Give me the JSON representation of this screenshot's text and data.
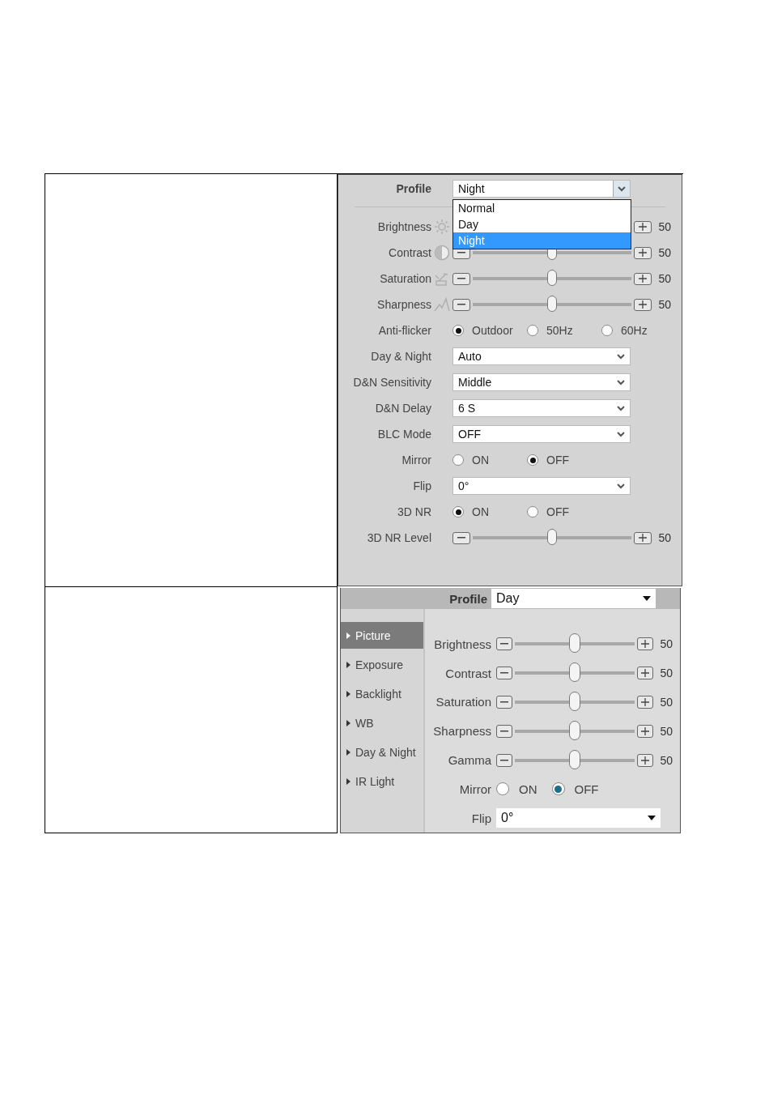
{
  "settings_panel": {
    "profile": {
      "label": "Profile",
      "value": "Night",
      "options": [
        {
          "label": "Normal",
          "selected": false
        },
        {
          "label": "Day",
          "selected": false
        },
        {
          "label": "Night",
          "selected": true
        }
      ]
    },
    "rows": [
      {
        "kind": "slider",
        "label": "Brightness",
        "reading": "50"
      },
      {
        "kind": "slider",
        "label": "Contrast",
        "level": 0.5,
        "reading": "50"
      },
      {
        "kind": "slider",
        "label": "Saturation",
        "level": 0.5,
        "reading": "50"
      },
      {
        "kind": "slider",
        "label": "Sharpness",
        "level": 0.5,
        "reading": "50"
      },
      {
        "kind": "radio",
        "label": "Anti-flicker",
        "options": [
          {
            "label": "Outdoor",
            "selected": true
          },
          {
            "label": "50Hz",
            "selected": false
          },
          {
            "label": "60Hz",
            "selected": false
          }
        ]
      },
      {
        "kind": "select",
        "label": "Day & Night",
        "value": "Auto"
      },
      {
        "kind": "select",
        "label": "D&N Sensitivity",
        "value": "Middle"
      },
      {
        "kind": "select",
        "label": "D&N Delay",
        "value": "6 S"
      },
      {
        "kind": "select",
        "label": "BLC Mode",
        "value": "OFF"
      },
      {
        "kind": "radio",
        "label": "Mirror",
        "options": [
          {
            "label": "ON",
            "selected": false
          },
          {
            "label": "OFF",
            "selected": true
          }
        ]
      },
      {
        "kind": "select",
        "label": "Flip",
        "value": "0°"
      },
      {
        "kind": "radio",
        "label": "3D NR",
        "options": [
          {
            "label": "ON",
            "selected": true
          },
          {
            "label": "OFF",
            "selected": false
          }
        ]
      },
      {
        "kind": "slider",
        "label": "3D NR Level",
        "level": 0.5,
        "reading": "50"
      }
    ]
  },
  "picture_panel": {
    "profile": {
      "label": "Profile",
      "value": "Day"
    },
    "menu": [
      {
        "label": "Picture",
        "selected": true
      },
      {
        "label": "Exposure",
        "selected": false
      },
      {
        "label": "Backlight",
        "selected": false
      },
      {
        "label": "WB",
        "selected": false
      },
      {
        "label": "Day & Night",
        "selected": false
      },
      {
        "label": "IR Light",
        "selected": false
      }
    ],
    "rows": [
      {
        "kind": "slider",
        "label": "Brightness",
        "level": 0.5,
        "reading": "50"
      },
      {
        "kind": "slider",
        "label": "Contrast",
        "level": 0.5,
        "reading": "50"
      },
      {
        "kind": "slider",
        "label": "Saturation",
        "level": 0.5,
        "reading": "50"
      },
      {
        "kind": "slider",
        "label": "Sharpness",
        "level": 0.5,
        "reading": "50"
      },
      {
        "kind": "slider",
        "label": "Gamma",
        "level": 0.5,
        "reading": "50"
      },
      {
        "kind": "radio",
        "label": "Mirror",
        "options": [
          {
            "label": "ON",
            "selected": false
          },
          {
            "label": "OFF",
            "selected": true
          }
        ]
      },
      {
        "kind": "select",
        "label": "Flip",
        "value": "0°"
      }
    ]
  }
}
